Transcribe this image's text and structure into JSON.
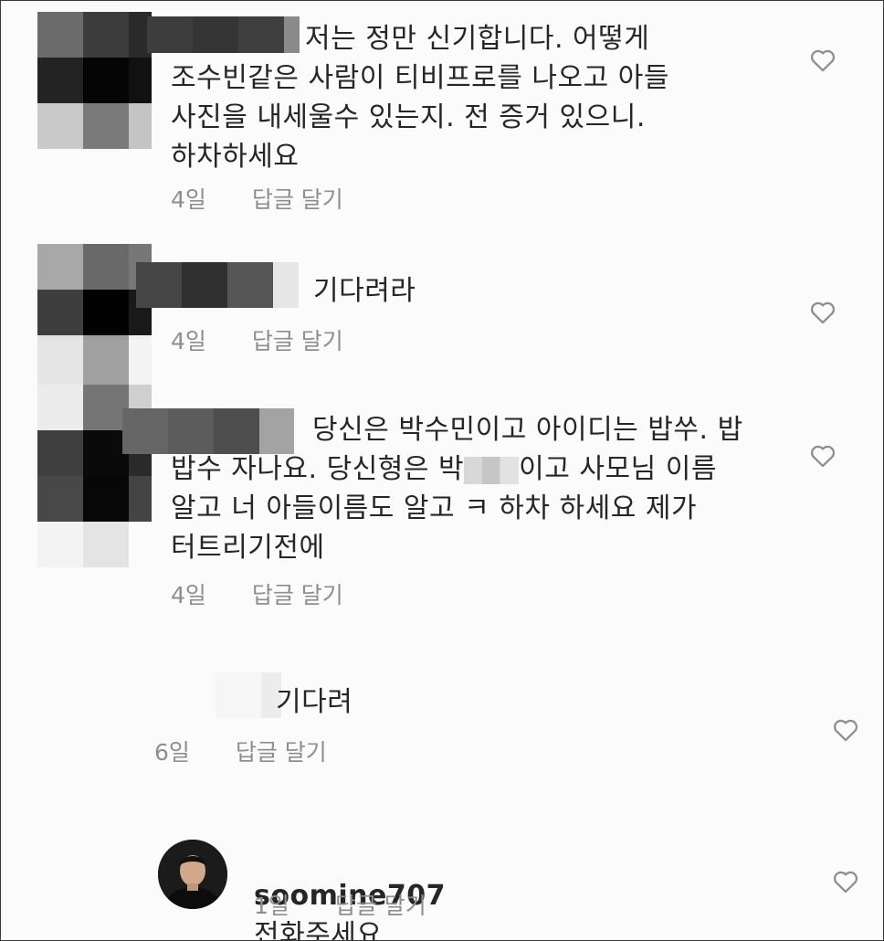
{
  "comments": [
    {
      "text": "저는 정만 신기합니다. 어떻게\n조수빈같은 사람이 티비프로를 나오고 아들\n사진을 내세울수 있는지. 전 증거 있으니.\n하차하세요",
      "time": "4일",
      "reply_label": "답글 달기"
    },
    {
      "text": "기다려라",
      "time": "4일",
      "reply_label": "답글 달기"
    },
    {
      "text_part1": "당신은 박수민이고 아이디는 밥쑤. 밥\n밥수 자나요. 당신형은 박",
      "text_part2": "이고 사모님 이름\n알고 너 아들이름도 알고 ㅋ 하차 하세요 제가\n터트리기전에",
      "time": "4일",
      "reply_label": "답글 달기"
    },
    {
      "text": "기다려",
      "time": "6일",
      "reply_label": "답글 달기"
    },
    {
      "username": "soomine707",
      "text": "전화주세요",
      "time": "1일",
      "reply_label": "답글 달기"
    }
  ],
  "icons": {
    "like": "heart-outline-icon"
  },
  "colors": {
    "text": "#262626",
    "meta": "#8e8e8e",
    "background": "#fbfbfb"
  }
}
